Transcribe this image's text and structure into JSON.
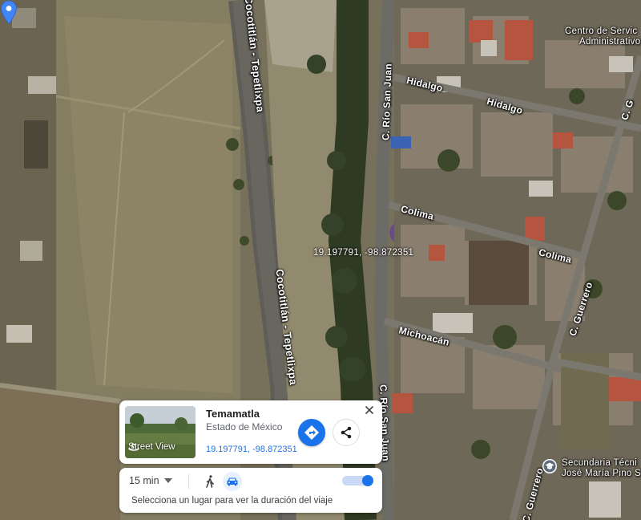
{
  "map": {
    "labels": {
      "road_north": "Cocotitlán - Tepetlixpa",
      "road_south": "Cocotitlán - Tepetlixpa",
      "rio_san_juan_north": "C. Río San Juan",
      "rio_san_juan_south": "C. Río San Juan",
      "hidalgo_west": "Hidalgo",
      "hidalgo_east": "Hidalgo",
      "colima_west": "Colima",
      "colima_east": "Colima",
      "michoacan": "Michoacán",
      "guerrero_north": "C. Guerrero",
      "guerrero_south": "C. Guerrero",
      "guerrero_top": "C. G",
      "poi_centro_line1": "Centro de Servic",
      "poi_centro_line2": "Administrativo",
      "poi_secundaria_line1": "Secundaria Técni",
      "poi_secundaria_line2": "José María Pino S"
    },
    "pin_coords_label": "19.197791, -98.872351"
  },
  "info_card": {
    "street_view_label": "Street View",
    "title": "Temamatla",
    "subtitle": "Estado de México",
    "coordinates": "19.197791, -98.872351"
  },
  "travel_card": {
    "time_value": "15 min",
    "hint": "Selecciona un lugar para ver la duración del viaje",
    "toggle_on": true
  },
  "colors": {
    "accent_blue": "#1a73e8",
    "pin_blue": "#4285f4"
  }
}
